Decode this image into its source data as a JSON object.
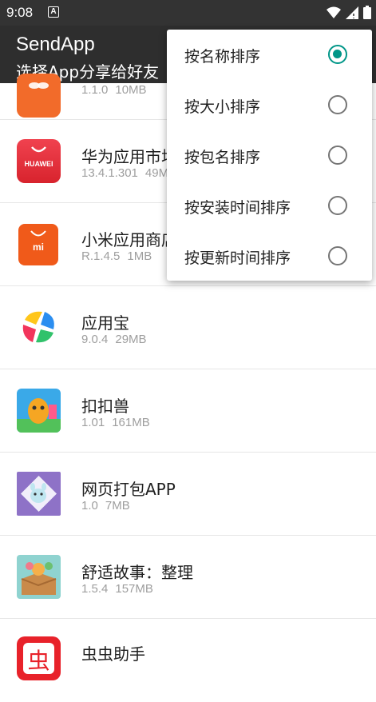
{
  "status_bar": {
    "time": "9:08",
    "notification_icon": "A"
  },
  "header": {
    "title": "SendApp",
    "subtitle": "选择App分享给好友"
  },
  "apps": [
    {
      "name": "",
      "version": "1.1.0",
      "size": "10MB",
      "icon": "orange-app-icon"
    },
    {
      "name": "华为应用市场",
      "version": "13.4.1.301",
      "size": "49MB",
      "icon": "huawei-appgallery-icon",
      "icon_text": "HUAWEI"
    },
    {
      "name": "小米应用商店",
      "version": "R.1.4.5",
      "size": "1MB",
      "icon": "xiaomi-appstore-icon",
      "icon_text": "mi"
    },
    {
      "name": "应用宝",
      "version": "9.0.4",
      "size": "29MB",
      "icon": "yingyongbao-icon"
    },
    {
      "name": "扣扣兽",
      "version": "1.01",
      "size": "161MB",
      "icon": "koukoushou-icon"
    },
    {
      "name": "网页打包APP",
      "version": "1.0",
      "size": "7MB",
      "icon": "web-packager-icon"
    },
    {
      "name": "舒适故事：整理",
      "version": "1.5.4",
      "size": "157MB",
      "icon": "cozy-story-icon"
    },
    {
      "name": "虫虫助手",
      "version": "",
      "size": "",
      "icon": "chongchong-icon",
      "icon_text": "虫"
    }
  ],
  "sort_menu": {
    "options": [
      {
        "label": "按名称排序",
        "selected": true
      },
      {
        "label": "按大小排序",
        "selected": false
      },
      {
        "label": "按包名排序",
        "selected": false
      },
      {
        "label": "按安装时间排序",
        "selected": false
      },
      {
        "label": "按更新时间排序",
        "selected": false
      }
    ]
  },
  "colors": {
    "accent": "#009688",
    "app_bar": "#2e2e2e",
    "status_bar": "#333333"
  }
}
